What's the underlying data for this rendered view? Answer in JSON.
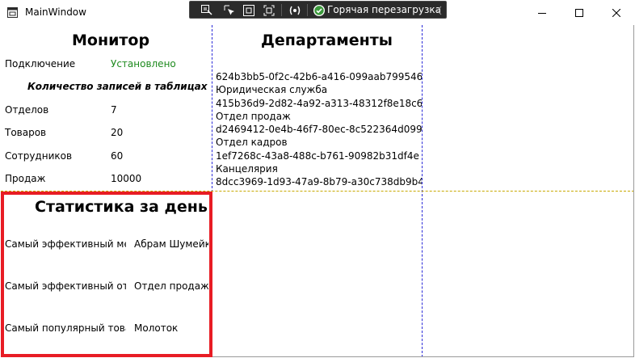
{
  "window": {
    "title": "MainWindow",
    "controls": [
      "minimize",
      "maximize",
      "close"
    ]
  },
  "devtools": {
    "icons": [
      "select-element-icon",
      "live-visual-tree-icon",
      "display-layout-adorners-icon",
      "track-focus-icon",
      "binding-failures-icon"
    ],
    "hot_reload_label": "Горячая перезагрузка"
  },
  "monitor": {
    "title": "Монитор",
    "connection_label": "Подключение",
    "connection_status": "Установлено",
    "connection_color": "#1e8a1e",
    "counts_heading": "Количество записей в таблицах",
    "rows": [
      {
        "label": "Отделов",
        "value": "7"
      },
      {
        "label": "Товаров",
        "value": "20"
      },
      {
        "label": "Сотрудников",
        "value": "60"
      },
      {
        "label": "Продаж",
        "value": "10000"
      }
    ]
  },
  "departments": {
    "title": "Департаменты",
    "lines": [
      "624b3bb5-0f2c-42b6-a416-099aab799546",
      "Юридическая служба",
      "415b36d9-2d82-4a92-a313-48312f8e18c6",
      "Отдел продаж",
      "d2469412-0e4b-46f7-80ec-8c522364d099",
      "Отдел кадров",
      "1ef7268c-43a8-488c-b761-90982b31df4e",
      "Канцелярия",
      "8dcc3969-1d93-47a9-8b79-a30c738db9b4"
    ]
  },
  "stats": {
    "title": "Статистика за день",
    "highlight_color": "#e81c24",
    "rows": [
      {
        "label": "Самый эффективный менеджер:",
        "value": "Абрам Шумейко"
      },
      {
        "label": "Самый эффективный отдел:",
        "value": "Отдел продаж"
      },
      {
        "label": "Самый популярный товар:",
        "value": "Молоток"
      }
    ]
  }
}
